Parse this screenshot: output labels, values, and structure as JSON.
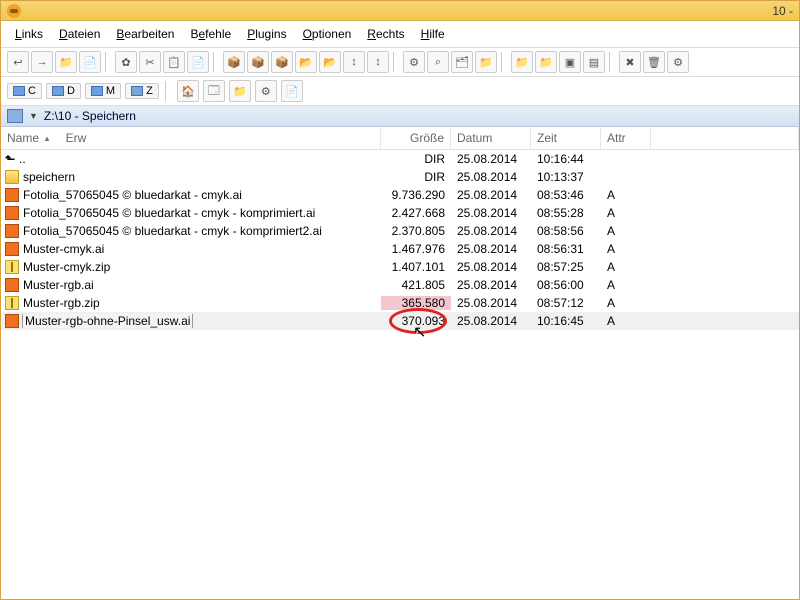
{
  "title_right": "10 -",
  "menu": {
    "links": "Links",
    "dateien": "Dateien",
    "bearbeiten": "Bearbeiten",
    "befehle": "Befehle",
    "plugins": "Plugins",
    "optionen": "Optionen",
    "rechts": "Rechts",
    "hilfe": "Hilfe"
  },
  "toolbar1": [
    "↩",
    "→",
    "📁",
    "📄",
    "",
    "✿",
    "✂",
    "📋",
    "📄",
    "",
    "📦",
    "📦",
    "📦",
    "📂",
    "📂",
    "↕",
    "↕",
    "",
    "⚙",
    "⌕",
    "🗂",
    "📁",
    "",
    "📁",
    "📁",
    "▣",
    "▤",
    "",
    "✖",
    "🗑",
    "⚙"
  ],
  "toolbar2_drives": [
    "C",
    "D",
    "M",
    "Z"
  ],
  "toolbar2_icons": [
    "🏠",
    "🗔",
    "📁",
    "⚙",
    "📄"
  ],
  "path": "Z:\\10 - Speichern",
  "columns": {
    "name": "Name",
    "erw": "Erw",
    "size": "Größe",
    "date": "Datum",
    "time": "Zeit",
    "attr": "Attr"
  },
  "rows": [
    {
      "type": "up",
      "name": "..",
      "size": "DIR",
      "date": "25.08.2014",
      "time": "10:16:44",
      "attr": ""
    },
    {
      "type": "folder",
      "name": "speichern",
      "size": "DIR",
      "date": "25.08.2014",
      "time": "10:13:37",
      "attr": ""
    },
    {
      "type": "ai",
      "name": "Fotolia_57065045 © bluedarkat - cmyk.ai",
      "size": "9.736.290",
      "date": "25.08.2014",
      "time": "08:53:46",
      "attr": "A"
    },
    {
      "type": "ai",
      "name": "Fotolia_57065045 © bluedarkat - cmyk - komprimiert.ai",
      "size": "2.427.668",
      "date": "25.08.2014",
      "time": "08:55:28",
      "attr": "A"
    },
    {
      "type": "ai",
      "name": "Fotolia_57065045 © bluedarkat - cmyk - komprimiert2.ai",
      "size": "2.370.805",
      "date": "25.08.2014",
      "time": "08:58:56",
      "attr": "A"
    },
    {
      "type": "ai",
      "name": "Muster-cmyk.ai",
      "size": "1.467.976",
      "date": "25.08.2014",
      "time": "08:56:31",
      "attr": "A"
    },
    {
      "type": "zip",
      "name": "Muster-cmyk.zip",
      "size": "1.407.101",
      "date": "25.08.2014",
      "time": "08:57:25",
      "attr": "A"
    },
    {
      "type": "ai",
      "name": "Muster-rgb.ai",
      "size": "421.805",
      "date": "25.08.2014",
      "time": "08:56:00",
      "attr": "A"
    },
    {
      "type": "zip",
      "name": "Muster-rgb.zip",
      "size": "365.580",
      "date": "25.08.2014",
      "time": "08:57:12",
      "attr": "A",
      "hl": true
    },
    {
      "type": "ai",
      "name": "Muster-rgb-ohne-Pinsel_usw.ai",
      "size": "370.093",
      "date": "25.08.2014",
      "time": "10:16:45",
      "attr": "A",
      "selected": true,
      "circle": true
    }
  ]
}
